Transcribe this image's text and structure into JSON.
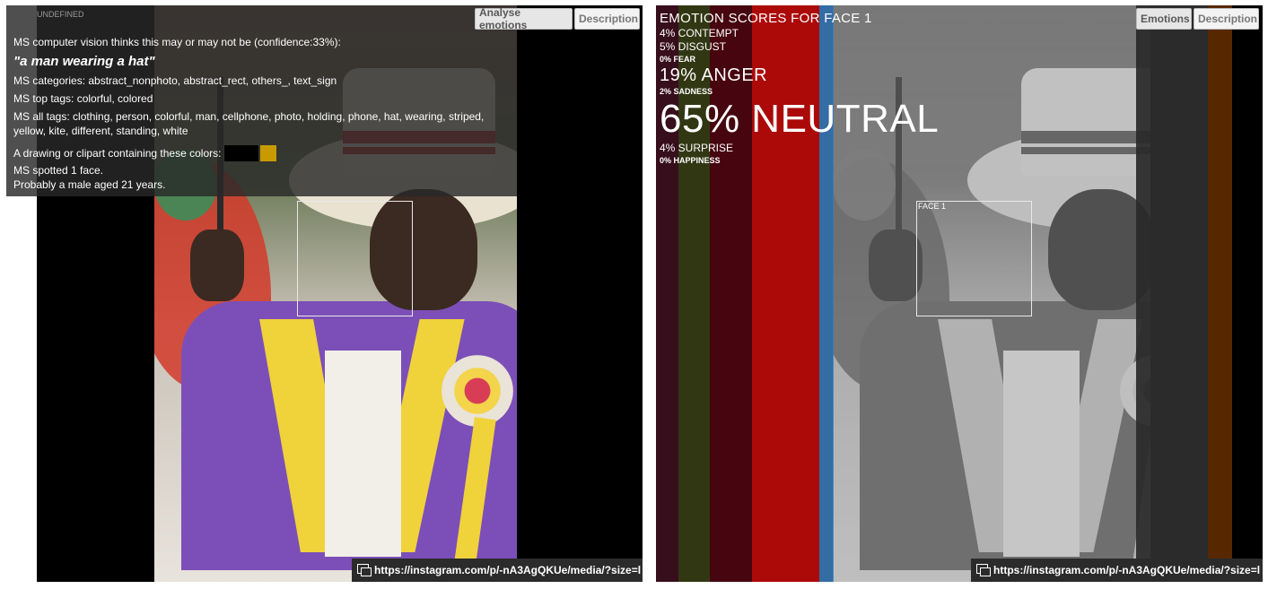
{
  "left": {
    "undefined_label": "UNDEFINED",
    "buttons": {
      "analyse": "Analyse emotions",
      "description": "Description"
    },
    "info": {
      "confidence_line": "MS computer vision thinks this may or may not be (confidence:33%):",
      "caption": "\"a man wearing a hat\"",
      "categories": "MS categories: abstract_nonphoto, abstract_rect, others_, text_sign",
      "top_tags": "MS top tags: colorful, colored",
      "all_tags": "MS all tags: clothing, person, colorful, man, cellphone, photo, holding, phone, hat, wearing, striped, yellow, kite, different, standing, white",
      "colors_label": "A drawing or clipart containing these colors:",
      "swatch_colors": [
        "#000000",
        "#c89a00"
      ],
      "faces_line": "MS spotted 1 face.",
      "age_line": "Probably a male aged 21 years."
    },
    "link": "https://instagram.com/p/-nA3AgQKUe/media/?size=l"
  },
  "right": {
    "buttons": {
      "emotions": "Emotions",
      "description": "Description"
    },
    "title": "EMOTION SCORES FOR FACE 1",
    "scores": [
      {
        "label": "4% CONTEMPT",
        "size": "s1"
      },
      {
        "label": "5% DISGUST",
        "size": "s1"
      },
      {
        "label": "0% FEAR",
        "size": "s0"
      },
      {
        "label": "19% ANGER",
        "size": "s2"
      },
      {
        "label": "2% SADNESS",
        "size": "s0"
      },
      {
        "label": "65% NEUTRAL",
        "size": "s3"
      },
      {
        "label": "4% SURPRISE",
        "size": "s1"
      },
      {
        "label": "0% HAPPINESS",
        "size": "s0"
      }
    ],
    "face_label": "FACE 1",
    "stripe_colors": [
      "#3a0f1c",
      "#343a14",
      "#4a0510",
      "#c40a0a",
      "#3d7fc1",
      "#cfcfcf",
      "#2d2d2d",
      "#5c2a00"
    ],
    "link": "https://instagram.com/p/-nA3AgQKUe/media/?size=l"
  }
}
